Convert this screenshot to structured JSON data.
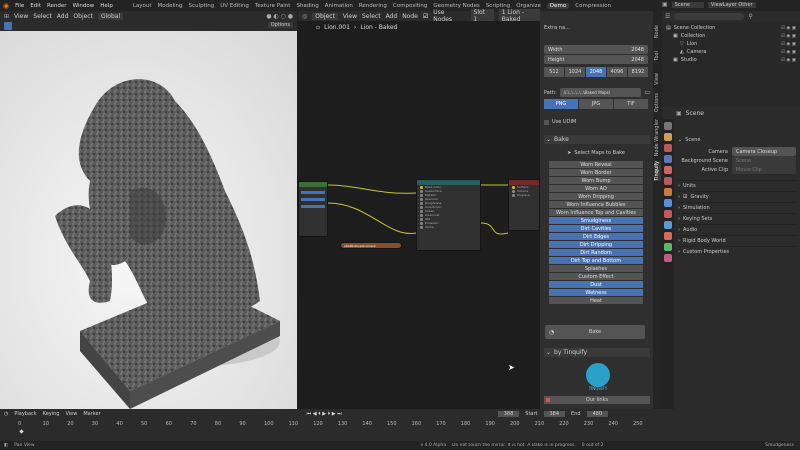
{
  "menu": [
    "File",
    "Edit",
    "Render",
    "Window",
    "Help"
  ],
  "workspaces": [
    "Layout",
    "Modeling",
    "Sculpting",
    "UV Editing",
    "Texture Paint",
    "Shading",
    "Animation",
    "Rendering",
    "Compositing",
    "Geometry Nodes",
    "Scripting",
    "Organize",
    "Demo",
    "Compression"
  ],
  "active_workspace": "Demo",
  "scene_name": "Scene",
  "view_layer": "ViewLayer Other",
  "viewport": {
    "header": [
      "Object Mode",
      "View",
      "Select",
      "Add",
      "Object"
    ],
    "orientation": "Global",
    "options": "Options"
  },
  "node_editor": {
    "header": [
      "Object",
      "View",
      "Select",
      "Add",
      "Node"
    ],
    "use_nodes": "Use Nodes",
    "slot": "Slot 1",
    "material": "1 Lion - Baked",
    "breadcrumb": [
      "Lion.001",
      "Lion - Baked"
    ],
    "node_label": "sRGBtoDisplacement"
  },
  "npanel": {
    "extra": "Extra na...",
    "width_label": "Width",
    "width_val": "2048",
    "height_label": "Height",
    "height_val": "2048",
    "res_options": [
      "512",
      "1024",
      "2048",
      "4096",
      "8192"
    ],
    "res_selected": 2,
    "path_label": "Path:",
    "path_val": "//.\\..\\..\\..\\..\\Baked Maps\\",
    "formats": [
      "PNG",
      "JPG",
      "TIF"
    ],
    "format_selected": 0,
    "use_udim": "Use UDIM",
    "bake_section": "Bake",
    "select_maps": "Select Maps to Bake",
    "maps": [
      {
        "label": "Worn Reveal",
        "on": false
      },
      {
        "label": "Worn Border",
        "on": false
      },
      {
        "label": "Worn Bump",
        "on": false
      },
      {
        "label": "Worn AO",
        "on": false
      },
      {
        "label": "Worn Dripping",
        "on": false
      },
      {
        "label": "Worn Influence Bubbles",
        "on": false
      },
      {
        "label": "Worn Influence Top and Cavities",
        "on": false
      },
      {
        "label": "Smudginess",
        "on": true
      },
      {
        "label": "Dirt Cavities",
        "on": true
      },
      {
        "label": "Dirt Edges",
        "on": true
      },
      {
        "label": "Dirt Dripping",
        "on": true
      },
      {
        "label": "Dirt Random",
        "on": true
      },
      {
        "label": "Dirt Top and Bottom",
        "on": true
      },
      {
        "label": "Splashes",
        "on": false
      },
      {
        "label": "Custom Effect",
        "on": false
      },
      {
        "label": "Dust",
        "on": true
      },
      {
        "label": "Wetness",
        "on": true
      },
      {
        "label": "Heat",
        "on": false
      }
    ],
    "bake_button": "Bake",
    "by_section": "by Tinquify",
    "logo_text": "TINQUIFY",
    "our_links": "Our links"
  },
  "ntabs": [
    "Node",
    "Tool",
    "View",
    "Options",
    "Node Wrangler",
    "Tinquify"
  ],
  "outliner": {
    "rows": [
      {
        "label": "Scene Collection",
        "indent": 0
      },
      {
        "label": "Collection",
        "indent": 1
      },
      {
        "label": "Lion",
        "indent": 2
      },
      {
        "label": "Camera",
        "indent": 2
      },
      {
        "label": "Studio",
        "indent": 1
      }
    ]
  },
  "properties": {
    "crumb": "Scene",
    "section_scene": "Scene",
    "camera_label": "Camera",
    "camera_val": "Camera Closeup",
    "bg_label": "Background Scene",
    "bg_val": "Scene",
    "clip_label": "Active Clip",
    "clip_val": "Movie Clip",
    "panels": [
      "Units",
      "Gravity",
      "Simulation",
      "Keying Sets",
      "Audio",
      "Rigid Body World",
      "Custom Properties"
    ]
  },
  "timeline": {
    "header": [
      "Playback",
      "Keying",
      "View",
      "Marker"
    ],
    "current": "388",
    "start_label": "Start",
    "start": "384",
    "end_label": "End",
    "end": "480",
    "ticks": [
      "0",
      "10",
      "20",
      "30",
      "40",
      "50",
      "60",
      "70",
      "80",
      "90",
      "100",
      "110",
      "120",
      "130",
      "140",
      "150",
      "160",
      "170",
      "180",
      "190",
      "200",
      "210",
      "220",
      "230",
      "240",
      "250"
    ]
  },
  "status": {
    "left": "Pan View",
    "mid": "v 4.0 Alpha",
    "info": "Do not touch the mirror. It is hot. A Bake is in progress.",
    "objects": "0 out of 2",
    "right": "Smudgeness"
  }
}
